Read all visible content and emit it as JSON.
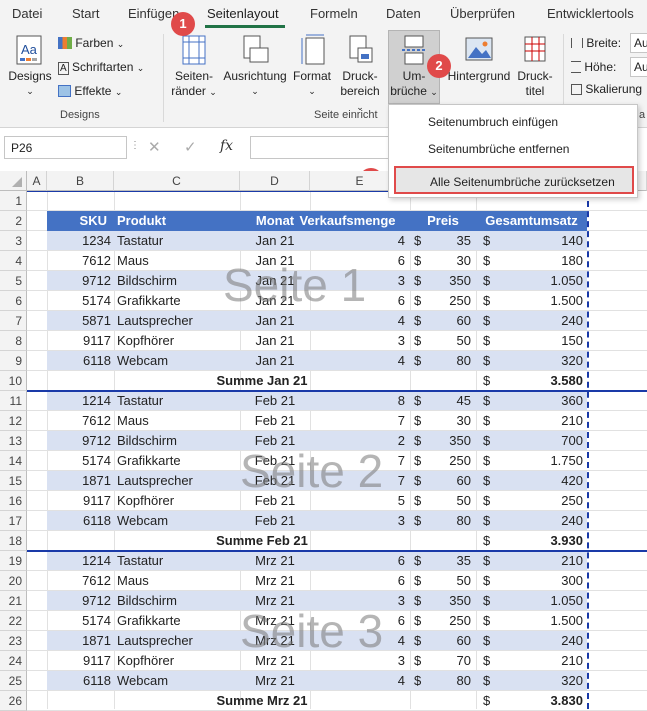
{
  "ribbon_tabs": [
    "Datei",
    "Start",
    "Einfügen",
    "Seitenlayout",
    "Formeln",
    "Daten",
    "Überprüfen",
    "Entwicklertools"
  ],
  "designs_group": {
    "designs_label": "Designs",
    "farben": "Farben",
    "schriftarten": "Schriftarten",
    "effekte": "Effekte",
    "group_label": "Designs"
  },
  "page_setup": {
    "seitenraender_1": "Seiten-",
    "seitenraender_2": "ränder",
    "ausrichtung": "Ausrichtung",
    "format": "Format",
    "druckbereich_1": "Druck-",
    "druckbereich_2": "bereich",
    "umbrueche_1": "Um-",
    "umbrueche_2": "brüche",
    "hintergrund": "Hintergrund",
    "drucktitel_1": "Druck-",
    "drucktitel_2": "titel",
    "group_label": "Seite einricht"
  },
  "scale_group": {
    "breite": "Breite:",
    "hoehe": "Höhe:",
    "skalierung": "Skalierung",
    "breite_val": "Au",
    "hoehe_val": "Au",
    "group_label": "a"
  },
  "badges": {
    "b1": "1",
    "b2": "2",
    "b3": "3"
  },
  "dropdown_items": [
    "Seitenumbruch einfügen",
    "Seitenumbrüche entfernen",
    "Alle Seitenumbrüche zurücksetzen"
  ],
  "name_box": "P26",
  "fx_label": "fx",
  "columns": [
    "A",
    "B",
    "C",
    "D",
    "E"
  ],
  "headers": {
    "sku": "SKU",
    "produkt": "Produkt",
    "monat": "Monat",
    "menge": "Verkaufsmenge",
    "preis": "Preis",
    "gesamt": "Gesamtumsatz"
  },
  "row_numbers": [
    "1",
    "2",
    "3",
    "4",
    "5",
    "6",
    "7",
    "8",
    "9",
    "10",
    "11",
    "12",
    "13",
    "14",
    "15",
    "16",
    "17",
    "18",
    "19",
    "20",
    "21",
    "22",
    "23",
    "24",
    "25",
    "26"
  ],
  "currency": "$",
  "data_rows": [
    {
      "sku": "1234",
      "produkt": "Tastatur",
      "monat": "Jan 21",
      "menge": "4",
      "preis": "35",
      "gesamt": "140"
    },
    {
      "sku": "7612",
      "produkt": "Maus",
      "monat": "Jan 21",
      "menge": "6",
      "preis": "30",
      "gesamt": "180"
    },
    {
      "sku": "9712",
      "produkt": "Bildschirm",
      "monat": "Jan 21",
      "menge": "3",
      "preis": "350",
      "gesamt": "1.050"
    },
    {
      "sku": "5174",
      "produkt": "Grafikkarte",
      "monat": "Jan 21",
      "menge": "6",
      "preis": "250",
      "gesamt": "1.500"
    },
    {
      "sku": "5871",
      "produkt": "Lautsprecher",
      "monat": "Jan 21",
      "menge": "4",
      "preis": "60",
      "gesamt": "240"
    },
    {
      "sku": "9117",
      "produkt": "Kopfhörer",
      "monat": "Jan 21",
      "menge": "3",
      "preis": "50",
      "gesamt": "150"
    },
    {
      "sku": "6118",
      "produkt": "Webcam",
      "monat": "Jan 21",
      "menge": "4",
      "preis": "80",
      "gesamt": "320"
    },
    {
      "summe": "Summe Jan 21",
      "gesamt": "3.580"
    },
    {
      "sku": "1214",
      "produkt": "Tastatur",
      "monat": "Feb 21",
      "menge": "8",
      "preis": "45",
      "gesamt": "360"
    },
    {
      "sku": "7612",
      "produkt": "Maus",
      "monat": "Feb 21",
      "menge": "7",
      "preis": "30",
      "gesamt": "210"
    },
    {
      "sku": "9712",
      "produkt": "Bildschirm",
      "monat": "Feb 21",
      "menge": "2",
      "preis": "350",
      "gesamt": "700"
    },
    {
      "sku": "5174",
      "produkt": "Grafikkarte",
      "monat": "Feb 21",
      "menge": "7",
      "preis": "250",
      "gesamt": "1.750"
    },
    {
      "sku": "1871",
      "produkt": "Lautsprecher",
      "monat": "Feb 21",
      "menge": "7",
      "preis": "60",
      "gesamt": "420"
    },
    {
      "sku": "9117",
      "produkt": "Kopfhörer",
      "monat": "Feb 21",
      "menge": "5",
      "preis": "50",
      "gesamt": "250"
    },
    {
      "sku": "6118",
      "produkt": "Webcam",
      "monat": "Feb 21",
      "menge": "3",
      "preis": "80",
      "gesamt": "240"
    },
    {
      "summe": "Summe Feb 21",
      "gesamt": "3.930"
    },
    {
      "sku": "1214",
      "produkt": "Tastatur",
      "monat": "Mrz 21",
      "menge": "6",
      "preis": "35",
      "gesamt": "210"
    },
    {
      "sku": "7612",
      "produkt": "Maus",
      "monat": "Mrz 21",
      "menge": "6",
      "preis": "50",
      "gesamt": "300"
    },
    {
      "sku": "9712",
      "produkt": "Bildschirm",
      "monat": "Mrz 21",
      "menge": "3",
      "preis": "350",
      "gesamt": "1.050"
    },
    {
      "sku": "5174",
      "produkt": "Grafikkarte",
      "monat": "Mrz 21",
      "menge": "6",
      "preis": "250",
      "gesamt": "1.500"
    },
    {
      "sku": "1871",
      "produkt": "Lautsprecher",
      "monat": "Mrz 21",
      "menge": "4",
      "preis": "60",
      "gesamt": "240"
    },
    {
      "sku": "9117",
      "produkt": "Kopfhörer",
      "monat": "Mrz 21",
      "menge": "3",
      "preis": "70",
      "gesamt": "210"
    },
    {
      "sku": "6118",
      "produkt": "Webcam",
      "monat": "Mrz 21",
      "menge": "4",
      "preis": "80",
      "gesamt": "320"
    },
    {
      "summe": "Summe Mrz 21",
      "gesamt": "3.830"
    }
  ],
  "watermarks": [
    "Seite 1",
    "Seite 2",
    "Seite 3"
  ],
  "colors": {
    "accent": "#217346",
    "header_fill": "#4472c4",
    "band_fill": "#d9e1f2",
    "page_break": "#1a3aa8",
    "badge": "#e04a4a"
  }
}
